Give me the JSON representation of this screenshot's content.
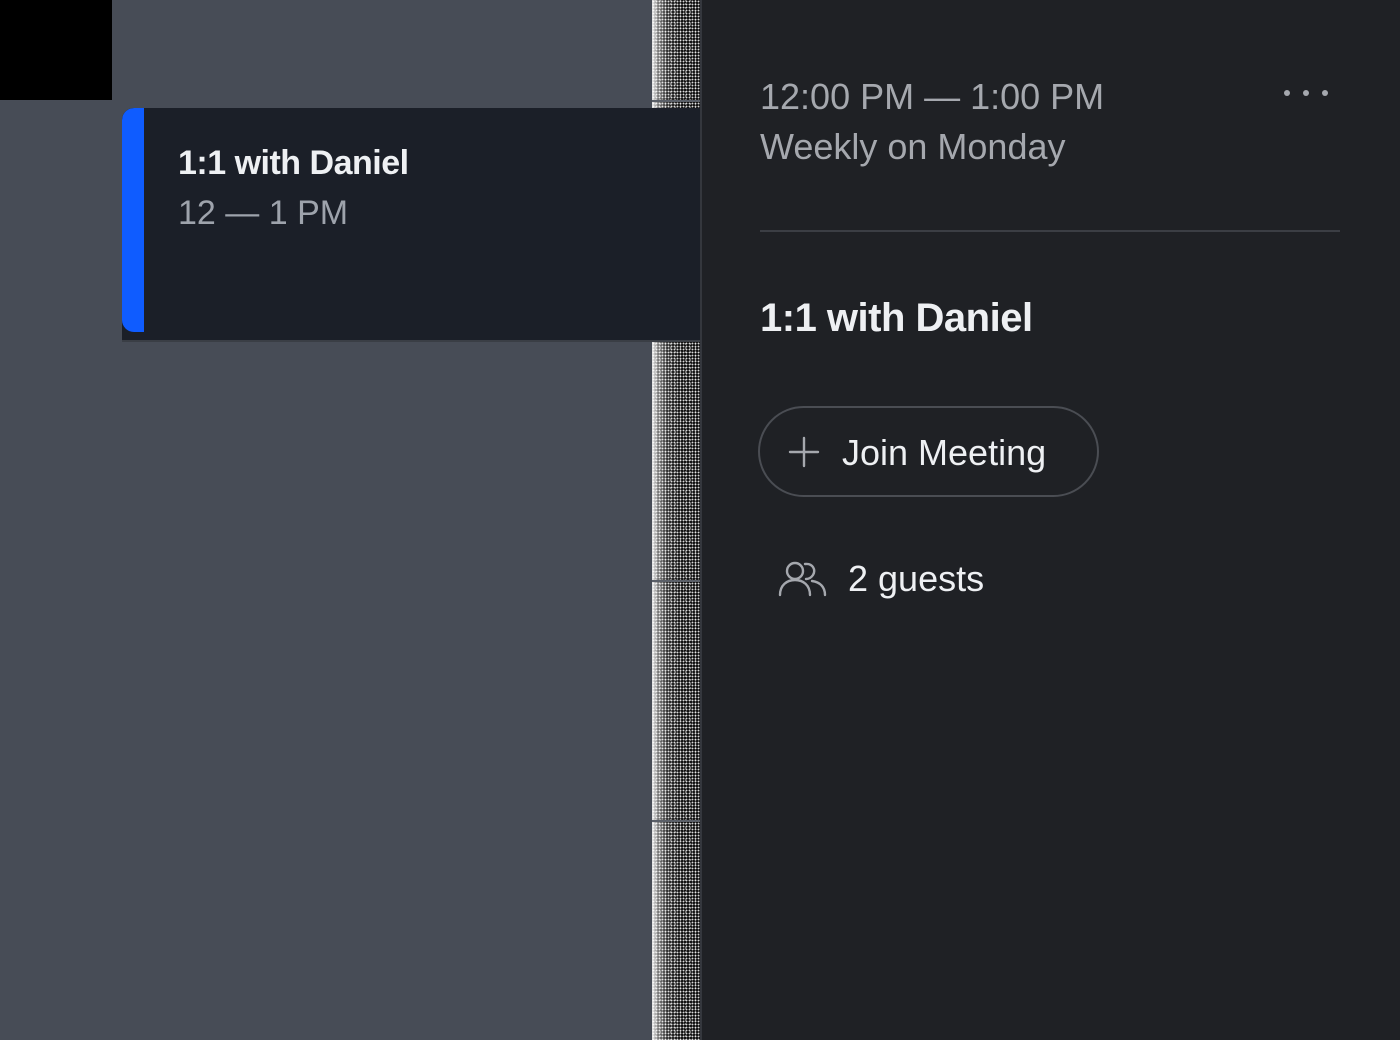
{
  "calendar": {
    "event": {
      "title": "1:1 with Daniel",
      "time": "12 — 1 PM",
      "accent_color": "#0f5cff"
    }
  },
  "detail_panel": {
    "time_range": "12:00 PM — 1:00 PM",
    "recurrence": "Weekly on Monday",
    "more_icon": "more-horizontal-icon",
    "title": "1:1 with Daniel",
    "join_button": {
      "icon": "plus-icon",
      "label": "Join Meeting"
    },
    "guests": {
      "icon": "people-icon",
      "label": "2 guests"
    }
  },
  "colors": {
    "calendar_background": "#474c56",
    "panel_background": "#1f2125",
    "event_card_background": "#1b1f28",
    "text_primary": "#eef0f3",
    "text_secondary": "#a5a8ae"
  }
}
